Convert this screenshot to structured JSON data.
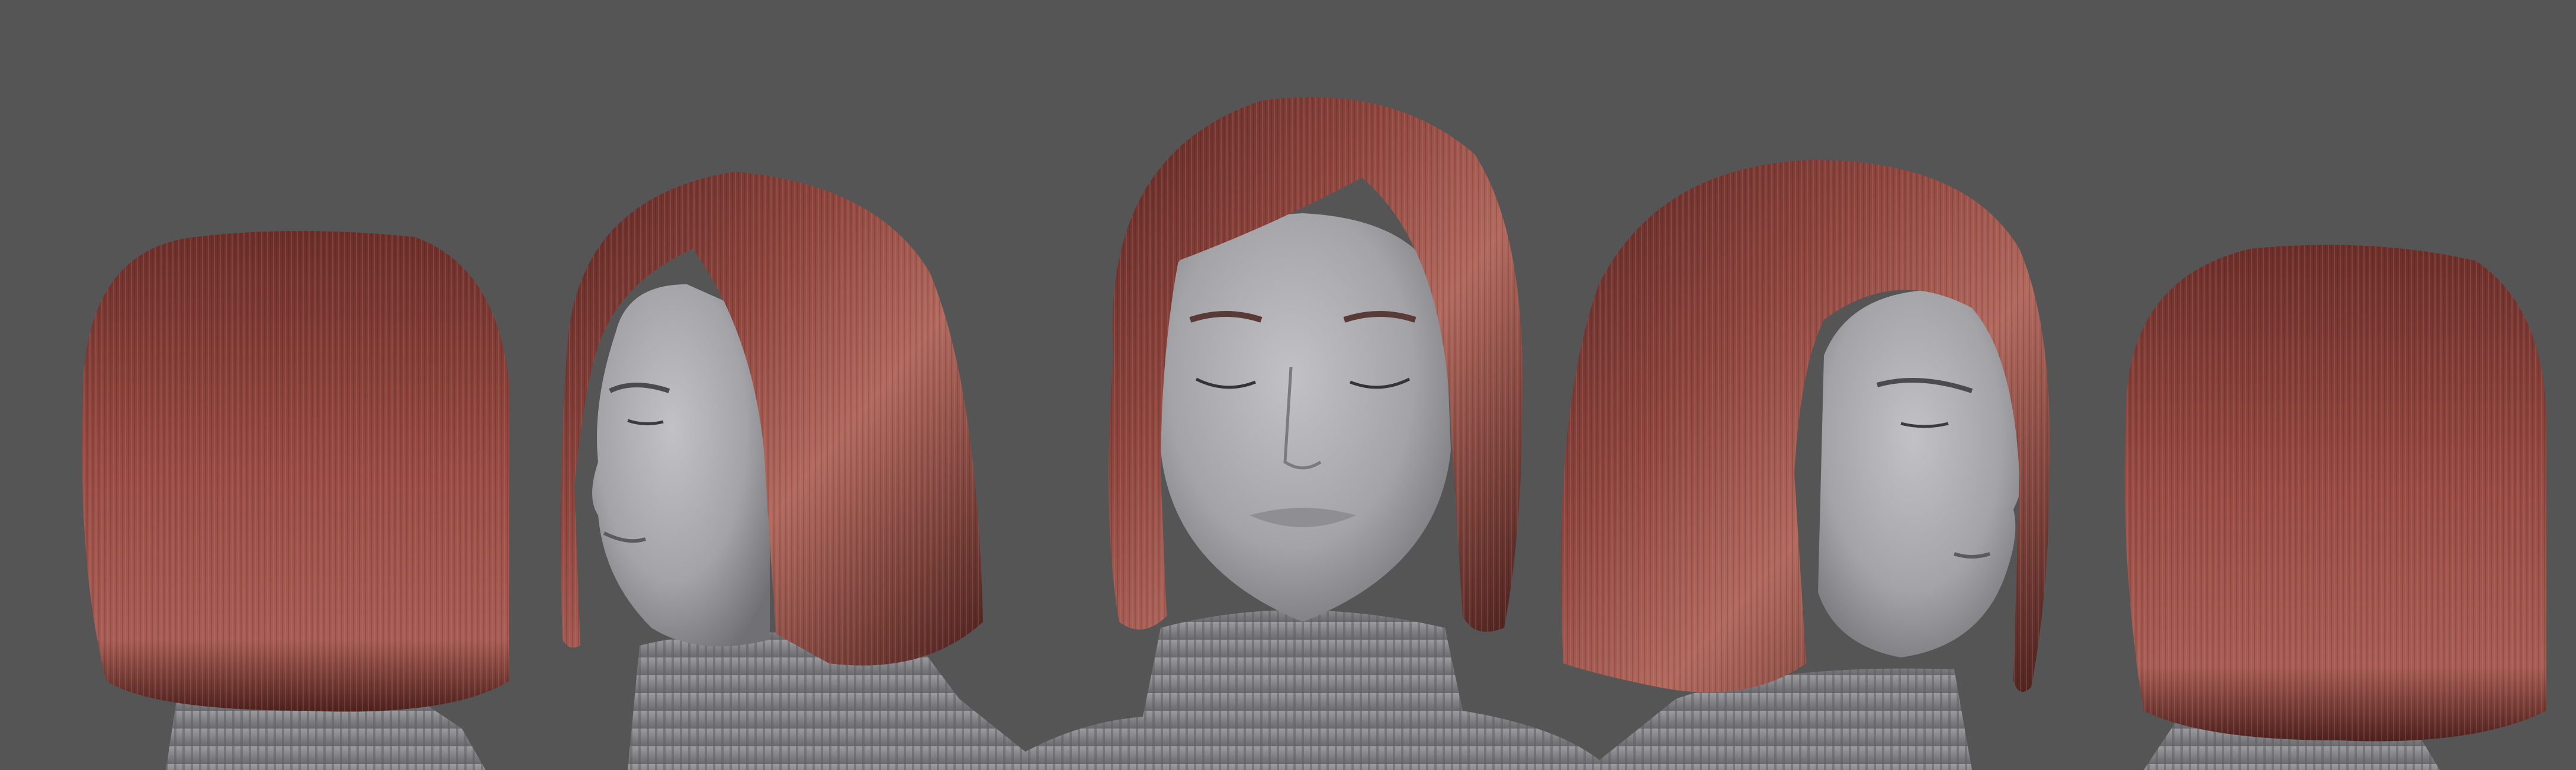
{
  "scene": {
    "background_color": "#555555",
    "subject": "bob-haircut-turnaround",
    "views": [
      {
        "id": "back-left",
        "label": ""
      },
      {
        "id": "three-quarter-left",
        "label": ""
      },
      {
        "id": "front",
        "label": ""
      },
      {
        "id": "three-quarter-right",
        "label": ""
      },
      {
        "id": "back-right",
        "label": ""
      }
    ],
    "colors": {
      "hair_base": "#7a3a34",
      "hair_highlight": "#b86a5f",
      "hair_shadow": "#3e1b19",
      "skin": "#a9a9ad",
      "skin_shadow": "#76767b",
      "sweater": "#8d8d90",
      "sweater_shadow": "#5e5e62"
    }
  }
}
